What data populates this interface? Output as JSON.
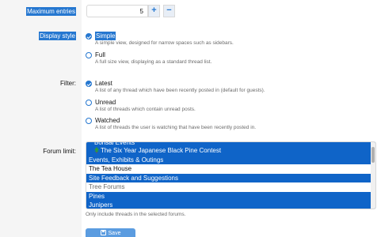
{
  "labels": {
    "max_entries": "Maximum entries",
    "display_style": "Display style",
    "filter": "Filter:",
    "forum_limit": "Forum limit:"
  },
  "max_entries": {
    "value": "5",
    "plus": "+",
    "minus": "−"
  },
  "display_style": {
    "options": [
      {
        "title": "Simple",
        "desc": "A simple view, designed for narrow spaces such as sidebars.",
        "checked": true
      },
      {
        "title": "Full",
        "desc": "A full size view, displaying as a standard thread list.",
        "checked": false
      }
    ]
  },
  "filter": {
    "options": [
      {
        "title": "Latest",
        "desc": "A list of any thread which have been recently posted in (default for guests).",
        "checked": true
      },
      {
        "title": "Unread",
        "desc": "A list of threads which contain unread posts.",
        "checked": false
      },
      {
        "title": "Watched",
        "desc": "A list of threads the user is watching that have been recently posted in.",
        "checked": false
      }
    ]
  },
  "forum_list": {
    "items": [
      {
        "label": "Bonsai Events",
        "selected": true,
        "kind": "partial"
      },
      {
        "label": "The Six Year Japanese Black Pine Contest",
        "selected": true,
        "kind": "tree"
      },
      {
        "label": "Events, Exhibits & Outings",
        "selected": true,
        "kind": "item"
      },
      {
        "label": "The Tea House",
        "selected": false,
        "kind": "item"
      },
      {
        "label": "Site Feedback and Suggestions",
        "selected": true,
        "kind": "item"
      },
      {
        "label": "Tree Forums",
        "selected": false,
        "kind": "group"
      },
      {
        "label": "Pines",
        "selected": true,
        "kind": "item"
      },
      {
        "label": "Junipers",
        "selected": true,
        "kind": "item"
      }
    ],
    "helper": "Only include threads in the selected forums."
  },
  "save": {
    "label": "Save"
  },
  "colors": {
    "accent": "#2577d0",
    "selected_row": "#0f64c8",
    "save_button": "#5b9ce0"
  }
}
